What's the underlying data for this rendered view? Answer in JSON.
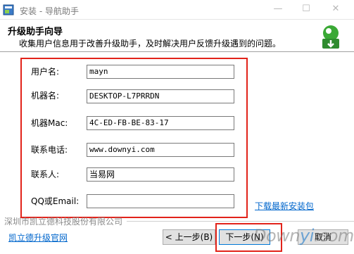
{
  "window": {
    "title": "安装 - 导航助手",
    "minimize_glyph": "—",
    "maximize_glyph": "☐",
    "close_glyph": "✕"
  },
  "header": {
    "title": "升级助手向导",
    "subtitle": "收集用户信息用于改善升级助手，及时解决用户反馈升级遇到的问题。"
  },
  "form": {
    "fields": [
      {
        "label": "用户名:",
        "value": "mayn"
      },
      {
        "label": "机器名:",
        "value": "DESKTOP-L7PRRDN"
      },
      {
        "label": "机器Mac:",
        "value": "4C-ED-FB-BE-83-17"
      },
      {
        "label": "联系电话:",
        "value": "www.downyi.com"
      },
      {
        "label": "联系人:",
        "value": "当易网"
      },
      {
        "label": "QQ或Email:",
        "value": ""
      }
    ]
  },
  "links": {
    "download": "下载最新安装包",
    "website": "凯立德升级官网"
  },
  "footer": {
    "company": "深圳市凯立德科技股份有限公司"
  },
  "buttons": {
    "back": "< 上一步(B)",
    "next": "下一步(N)",
    "cancel": "取消"
  },
  "watermark": {
    "text_a": "Down",
    "text_b": "yi",
    "text_c": ".com"
  },
  "colors": {
    "highlight": "#e2231a",
    "link": "#0066cc"
  },
  "icons": [
    "installer-app-icon",
    "upgrade-assistant-logo-icon"
  ]
}
